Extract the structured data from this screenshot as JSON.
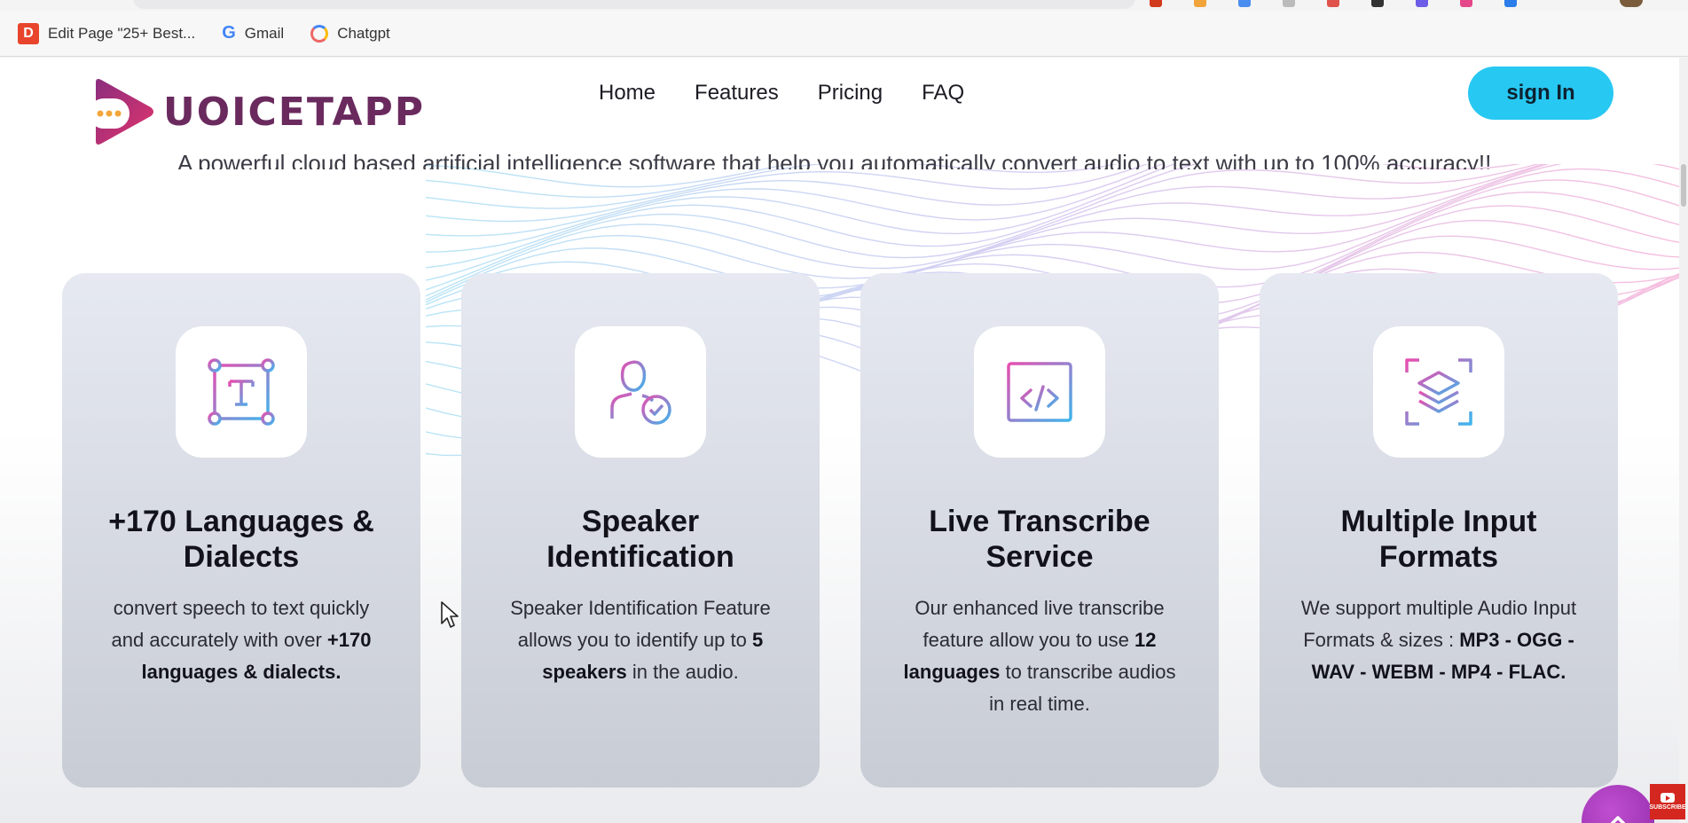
{
  "bookmarks": [
    {
      "label": "Edit Page \"25+ Best..."
    },
    {
      "label": "Gmail"
    },
    {
      "label": "Chatgpt"
    }
  ],
  "site": {
    "logo_text": "UOICETAPP",
    "nav": [
      "Home",
      "Features",
      "Pricing",
      "FAQ"
    ],
    "signin_label": "sign In",
    "subtitle": "A powerful cloud based artificial intelligence software that help you automatically convert audio to text with up to 100% accuracy!!"
  },
  "features": [
    {
      "icon": "text-frame-icon",
      "title_1": "+170 Languages &",
      "title_2": "Dialects",
      "body": [
        {
          "t": "convert speech to text quickly and accurately with over ",
          "b": false
        },
        {
          "t": "+170 languages & dialects.",
          "b": true
        }
      ]
    },
    {
      "icon": "user-check-icon",
      "title_1": "Speaker",
      "title_2": "Identification",
      "body": [
        {
          "t": "Speaker Identification Feature allows you to identify up to ",
          "b": false
        },
        {
          "t": "5 speakers",
          "b": true
        },
        {
          "t": " in the audio.",
          "b": false
        }
      ]
    },
    {
      "icon": "code-window-icon",
      "title_1": "Live Transcribe",
      "title_2": "Service",
      "body": [
        {
          "t": "Our enhanced live transcribe feature allow you to use ",
          "b": false
        },
        {
          "t": "12 languages",
          "b": true
        },
        {
          "t": " to transcribe audios in real time.",
          "b": false
        }
      ]
    },
    {
      "icon": "layers-scan-icon",
      "title_1": "Multiple Input",
      "title_2": "Formats",
      "body": [
        {
          "t": "We support multiple Audio Input Formats & sizes : ",
          "b": false
        },
        {
          "t": "MP3 - OGG - WAV - WEBM - MP4 - FLAC.",
          "b": true
        }
      ]
    }
  ],
  "colors": {
    "accent": "#27c8f2",
    "logo": "#6a2a5e",
    "fab": "#a23bbd"
  },
  "youtube_badge": "SUBSCRIBE"
}
